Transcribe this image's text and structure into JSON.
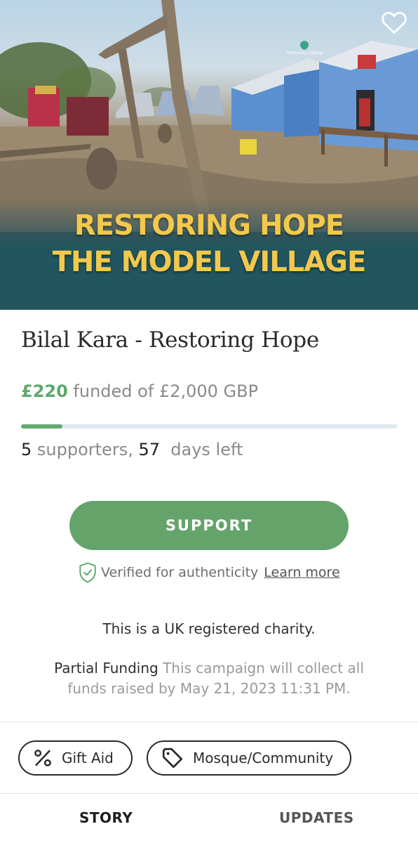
{
  "hero": {
    "title_line1": "RESTORING HOPE",
    "title_line2": "THE MODEL VILLAGE",
    "badge": "Humanity Calling",
    "favorite_icon": "heart-outline-icon"
  },
  "campaign": {
    "title": "Bilal Kara - Restoring Hope",
    "raised": "£220",
    "funded_text": " funded of £2,000 GBP",
    "progress": 0.11,
    "supporters_count": "5",
    "supporters_label": " supporters, ",
    "days_count": "57",
    "days_label": "  days left"
  },
  "support_button": {
    "label": "SUPPORT"
  },
  "verification": {
    "text": "Verified for authenticity",
    "link": "Learn more",
    "icon": "shield-check-icon"
  },
  "charity_note": "This is a UK registered charity.",
  "partial_funding": {
    "lead": "Partial Funding",
    "text": " This campaign will collect all funds raised by May 21, 2023 11:31 PM."
  },
  "tags": [
    {
      "label": "Gift Aid",
      "icon": "percent-icon"
    },
    {
      "label": "Mosque/Community",
      "icon": "tag-icon"
    }
  ],
  "tabs": [
    {
      "label": "STORY"
    },
    {
      "label": "UPDATES"
    }
  ],
  "colors": {
    "accent": "#64a46b",
    "hero_title": "#f2c94c",
    "teal_band": "#225560"
  }
}
